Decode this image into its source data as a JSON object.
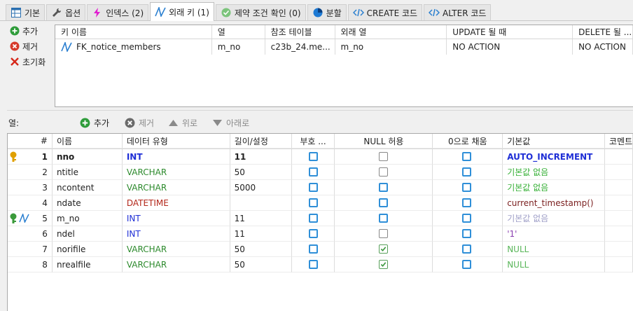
{
  "tabs": [
    {
      "label": "기본",
      "icon": "table-icon"
    },
    {
      "label": "옵션",
      "icon": "wrench-icon"
    },
    {
      "label": "인덱스 (2)",
      "icon": "lightning-icon"
    },
    {
      "label": "외래 키 (1)",
      "icon": "foreign-key-icon"
    },
    {
      "label": "제약 조건 확인 (0)",
      "icon": "check-icon"
    },
    {
      "label": "분할",
      "icon": "partition-icon"
    },
    {
      "label": "CREATE 코드",
      "icon": "code-icon"
    },
    {
      "label": "ALTER 코드",
      "icon": "code-icon"
    }
  ],
  "fk_actions": {
    "add": "추가",
    "remove": "제거",
    "reset": "초기화"
  },
  "fk_table": {
    "headers": [
      "키 이름",
      "열",
      "참조 테이블",
      "외래 열",
      "UPDATE 될 때",
      "DELETE 될 ..."
    ],
    "rows": [
      {
        "name": "FK_notice_members",
        "column": "m_no",
        "ref_table": "c23b_24.me...",
        "foreign_column": "m_no",
        "on_update": "NO ACTION",
        "on_delete": "NO ACTION"
      }
    ]
  },
  "columns_toolbar": {
    "label": "열:",
    "add": "추가",
    "remove": "제거",
    "up": "위로",
    "down": "아래로"
  },
  "columns_table": {
    "headers": {
      "num": "#",
      "name": "이름",
      "type": "데이터 유형",
      "length": "길이/설정",
      "unsigned": "부호 ...",
      "nullable": "NULL 허용",
      "zerofill": "0으로 채움",
      "default": "기본값",
      "comment": "코멘트"
    },
    "rows": [
      {
        "num": "1",
        "name": "nno",
        "type": "INT",
        "length": "11",
        "default": "AUTO_INCREMENT",
        "unsigned": false,
        "nullable": false,
        "zerofill": false
      },
      {
        "num": "2",
        "name": "ntitle",
        "type": "VARCHAR",
        "length": "50",
        "default": "기본값 없음",
        "unsigned": false,
        "nullable": false,
        "zerofill": false
      },
      {
        "num": "3",
        "name": "ncontent",
        "type": "VARCHAR",
        "length": "5000",
        "default": "기본값 없음",
        "unsigned": false,
        "nullable": false,
        "zerofill": false
      },
      {
        "num": "4",
        "name": "ndate",
        "type": "DATETIME",
        "length": "",
        "default": "current_timestamp()",
        "unsigned": false,
        "nullable": false,
        "zerofill": false
      },
      {
        "num": "5",
        "name": "m_no",
        "type": "INT",
        "length": "11",
        "default": "기본값 없음",
        "unsigned": false,
        "nullable": false,
        "zerofill": false
      },
      {
        "num": "6",
        "name": "ndel",
        "type": "INT",
        "length": "11",
        "default": "'1'",
        "unsigned": false,
        "nullable": false,
        "zerofill": false
      },
      {
        "num": "7",
        "name": "norifile",
        "type": "VARCHAR",
        "length": "50",
        "default": "NULL",
        "unsigned": false,
        "nullable": true,
        "zerofill": false
      },
      {
        "num": "8",
        "name": "nrealfile",
        "type": "VARCHAR",
        "length": "50",
        "default": "NULL",
        "unsigned": false,
        "nullable": true,
        "zerofill": false
      }
    ]
  },
  "colors": {
    "int": "#1f2fd6",
    "varchar": "#2c8a2c",
    "datetime": "#b3271a",
    "default_auto": "#1f2fd6",
    "default_none": "#37b037",
    "default_ts": "#7a1f1f",
    "default_null": "#58b558",
    "checkbox_blue": "#2f8fd8",
    "key_gold": "#e0a000",
    "key_green": "#3a9a3a"
  }
}
